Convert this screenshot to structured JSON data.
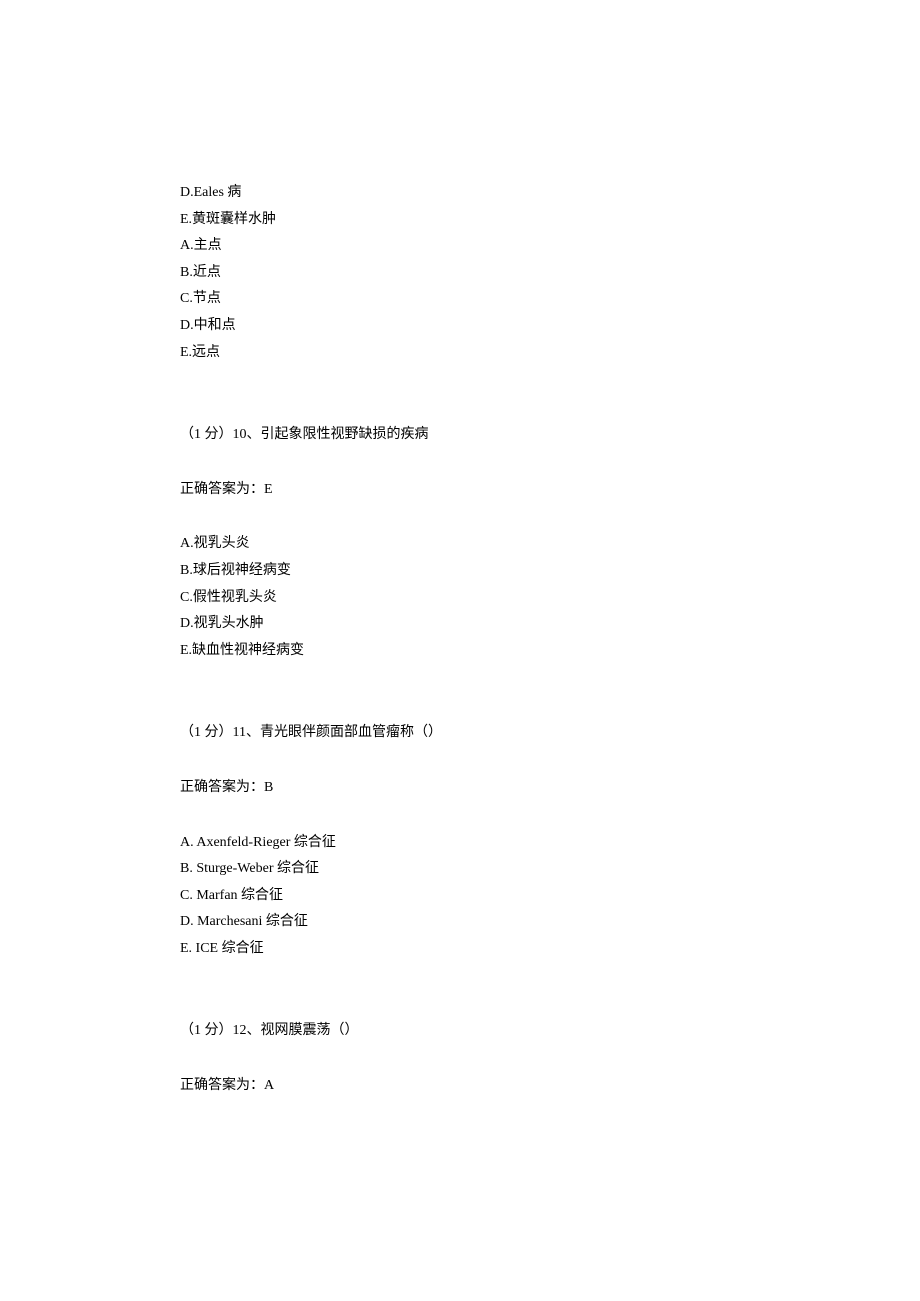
{
  "intro_options": [
    "D.Eales 病",
    "E.黄斑囊样水肿",
    "A.主点",
    "B.近点",
    "C.节点",
    "D.中和点",
    "E.远点"
  ],
  "questions": [
    {
      "header": "（1 分）10、引起象限性视野缺损的疾病",
      "answer_label": "正确答案为：E",
      "options": [
        "A.视乳头炎",
        "B.球后视神经病变",
        "C.假性视乳头炎",
        "D.视乳头水肿",
        "E.缺血性视神经病变"
      ]
    },
    {
      "header": "（1 分）11、青光眼伴颜面部血管瘤称（）",
      "answer_label": "正确答案为：B",
      "options": [
        "A.  Axenfeld-Rieger 综合征",
        "B.  Sturge-Weber 综合征",
        "C.  Marfan 综合征",
        "D.  Marchesani 综合征",
        "E.  ICE 综合征"
      ]
    },
    {
      "header": "（1 分）12、视网膜震荡（）",
      "answer_label": "正确答案为：A",
      "options": []
    }
  ]
}
